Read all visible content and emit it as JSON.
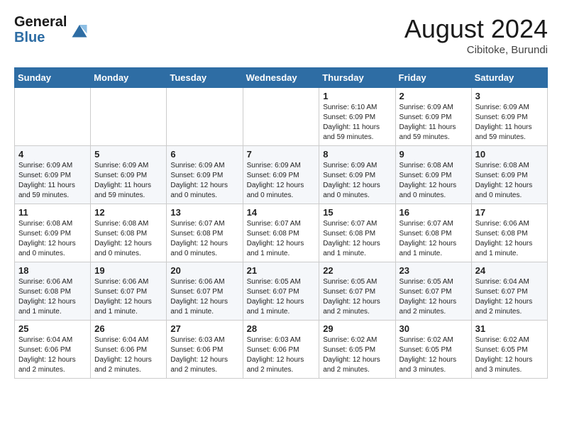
{
  "header": {
    "logo_general": "General",
    "logo_blue": "Blue",
    "month_title": "August 2024",
    "location": "Cibitoke, Burundi"
  },
  "weekdays": [
    "Sunday",
    "Monday",
    "Tuesday",
    "Wednesday",
    "Thursday",
    "Friday",
    "Saturday"
  ],
  "weeks": [
    [
      {
        "day": "",
        "info": ""
      },
      {
        "day": "",
        "info": ""
      },
      {
        "day": "",
        "info": ""
      },
      {
        "day": "",
        "info": ""
      },
      {
        "day": "1",
        "info": "Sunrise: 6:10 AM\nSunset: 6:09 PM\nDaylight: 11 hours\nand 59 minutes."
      },
      {
        "day": "2",
        "info": "Sunrise: 6:09 AM\nSunset: 6:09 PM\nDaylight: 11 hours\nand 59 minutes."
      },
      {
        "day": "3",
        "info": "Sunrise: 6:09 AM\nSunset: 6:09 PM\nDaylight: 11 hours\nand 59 minutes."
      }
    ],
    [
      {
        "day": "4",
        "info": "Sunrise: 6:09 AM\nSunset: 6:09 PM\nDaylight: 11 hours\nand 59 minutes."
      },
      {
        "day": "5",
        "info": "Sunrise: 6:09 AM\nSunset: 6:09 PM\nDaylight: 11 hours\nand 59 minutes."
      },
      {
        "day": "6",
        "info": "Sunrise: 6:09 AM\nSunset: 6:09 PM\nDaylight: 12 hours\nand 0 minutes."
      },
      {
        "day": "7",
        "info": "Sunrise: 6:09 AM\nSunset: 6:09 PM\nDaylight: 12 hours\nand 0 minutes."
      },
      {
        "day": "8",
        "info": "Sunrise: 6:09 AM\nSunset: 6:09 PM\nDaylight: 12 hours\nand 0 minutes."
      },
      {
        "day": "9",
        "info": "Sunrise: 6:08 AM\nSunset: 6:09 PM\nDaylight: 12 hours\nand 0 minutes."
      },
      {
        "day": "10",
        "info": "Sunrise: 6:08 AM\nSunset: 6:09 PM\nDaylight: 12 hours\nand 0 minutes."
      }
    ],
    [
      {
        "day": "11",
        "info": "Sunrise: 6:08 AM\nSunset: 6:09 PM\nDaylight: 12 hours\nand 0 minutes."
      },
      {
        "day": "12",
        "info": "Sunrise: 6:08 AM\nSunset: 6:08 PM\nDaylight: 12 hours\nand 0 minutes."
      },
      {
        "day": "13",
        "info": "Sunrise: 6:07 AM\nSunset: 6:08 PM\nDaylight: 12 hours\nand 0 minutes."
      },
      {
        "day": "14",
        "info": "Sunrise: 6:07 AM\nSunset: 6:08 PM\nDaylight: 12 hours\nand 1 minute."
      },
      {
        "day": "15",
        "info": "Sunrise: 6:07 AM\nSunset: 6:08 PM\nDaylight: 12 hours\nand 1 minute."
      },
      {
        "day": "16",
        "info": "Sunrise: 6:07 AM\nSunset: 6:08 PM\nDaylight: 12 hours\nand 1 minute."
      },
      {
        "day": "17",
        "info": "Sunrise: 6:06 AM\nSunset: 6:08 PM\nDaylight: 12 hours\nand 1 minute."
      }
    ],
    [
      {
        "day": "18",
        "info": "Sunrise: 6:06 AM\nSunset: 6:08 PM\nDaylight: 12 hours\nand 1 minute."
      },
      {
        "day": "19",
        "info": "Sunrise: 6:06 AM\nSunset: 6:07 PM\nDaylight: 12 hours\nand 1 minute."
      },
      {
        "day": "20",
        "info": "Sunrise: 6:06 AM\nSunset: 6:07 PM\nDaylight: 12 hours\nand 1 minute."
      },
      {
        "day": "21",
        "info": "Sunrise: 6:05 AM\nSunset: 6:07 PM\nDaylight: 12 hours\nand 1 minute."
      },
      {
        "day": "22",
        "info": "Sunrise: 6:05 AM\nSunset: 6:07 PM\nDaylight: 12 hours\nand 2 minutes."
      },
      {
        "day": "23",
        "info": "Sunrise: 6:05 AM\nSunset: 6:07 PM\nDaylight: 12 hours\nand 2 minutes."
      },
      {
        "day": "24",
        "info": "Sunrise: 6:04 AM\nSunset: 6:07 PM\nDaylight: 12 hours\nand 2 minutes."
      }
    ],
    [
      {
        "day": "25",
        "info": "Sunrise: 6:04 AM\nSunset: 6:06 PM\nDaylight: 12 hours\nand 2 minutes."
      },
      {
        "day": "26",
        "info": "Sunrise: 6:04 AM\nSunset: 6:06 PM\nDaylight: 12 hours\nand 2 minutes."
      },
      {
        "day": "27",
        "info": "Sunrise: 6:03 AM\nSunset: 6:06 PM\nDaylight: 12 hours\nand 2 minutes."
      },
      {
        "day": "28",
        "info": "Sunrise: 6:03 AM\nSunset: 6:06 PM\nDaylight: 12 hours\nand 2 minutes."
      },
      {
        "day": "29",
        "info": "Sunrise: 6:02 AM\nSunset: 6:05 PM\nDaylight: 12 hours\nand 2 minutes."
      },
      {
        "day": "30",
        "info": "Sunrise: 6:02 AM\nSunset: 6:05 PM\nDaylight: 12 hours\nand 3 minutes."
      },
      {
        "day": "31",
        "info": "Sunrise: 6:02 AM\nSunset: 6:05 PM\nDaylight: 12 hours\nand 3 minutes."
      }
    ]
  ]
}
